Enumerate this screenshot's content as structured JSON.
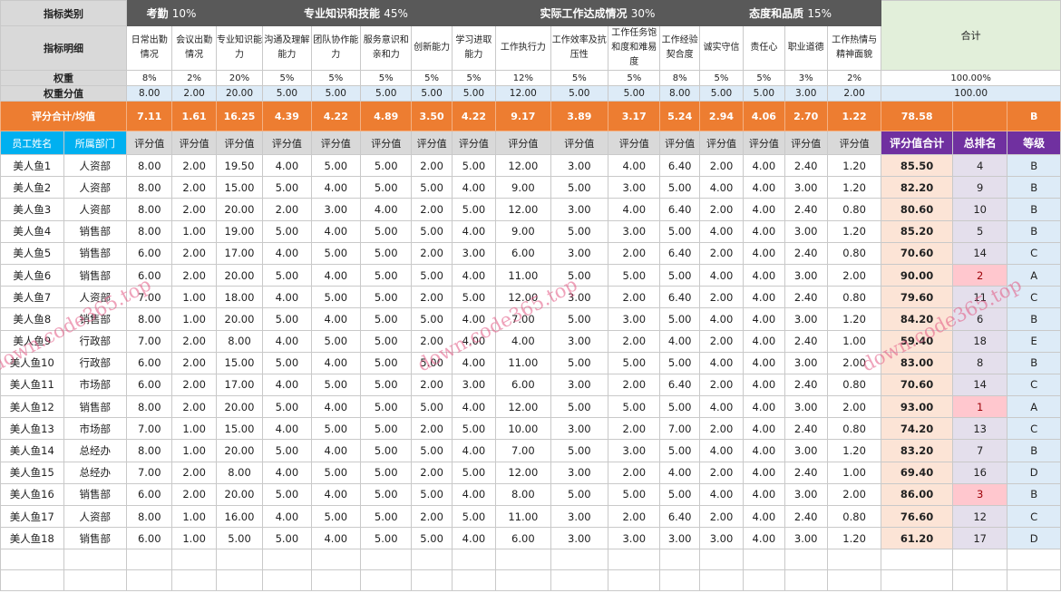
{
  "header": {
    "category_label": "指标类别",
    "categories": [
      {
        "name": "考勤",
        "weight": "10%"
      },
      {
        "name": "专业知识和技能",
        "weight": "45%"
      },
      {
        "name": "实际工作达成情况",
        "weight": "30%"
      },
      {
        "name": "态度和品质",
        "weight": "15%"
      }
    ],
    "total_label": "合计",
    "detail_label": "指标明细",
    "details": [
      "日常出勤情况",
      "会议出勤情况",
      "专业知识能力",
      "沟通及理解能力",
      "团队协作能力",
      "服务意识和亲和力",
      "创新能力",
      "学习进取能力",
      "工作执行力",
      "工作效率及抗压性",
      "工作任务饱和度和难易度",
      "工作经验契合度",
      "诚实守信",
      "责任心",
      "职业道德",
      "工作热情与精神面貌"
    ],
    "weight_label": "权重",
    "weights": [
      "8%",
      "2%",
      "20%",
      "5%",
      "5%",
      "5%",
      "5%",
      "5%",
      "12%",
      "5%",
      "5%",
      "8%",
      "5%",
      "5%",
      "3%",
      "2%"
    ],
    "weight_total": "100.00%",
    "weight_score_label": "权重分值",
    "weight_scores": [
      "8.00",
      "2.00",
      "20.00",
      "5.00",
      "5.00",
      "5.00",
      "5.00",
      "5.00",
      "12.00",
      "5.00",
      "5.00",
      "8.00",
      "5.00",
      "5.00",
      "3.00",
      "2.00"
    ],
    "weight_score_total": "100.00"
  },
  "summary": {
    "label": "评分合计/均值",
    "averages": [
      "7.11",
      "1.61",
      "16.25",
      "4.39",
      "4.22",
      "4.89",
      "3.50",
      "4.22",
      "9.17",
      "3.89",
      "3.17",
      "5.24",
      "2.94",
      "4.06",
      "2.70",
      "1.22"
    ],
    "total": "78.58",
    "grade": "B"
  },
  "columns": {
    "name": "员工姓名",
    "dept": "所属部门",
    "score": "评分值",
    "total": "评分值合计",
    "rank": "总排名",
    "grade": "等级"
  },
  "employees": [
    {
      "name": "美人鱼1",
      "dept": "人资部",
      "scores": [
        "8.00",
        "2.00",
        "19.50",
        "4.00",
        "5.00",
        "5.00",
        "2.00",
        "5.00",
        "12.00",
        "3.00",
        "4.00",
        "6.40",
        "2.00",
        "4.00",
        "2.40",
        "1.20"
      ],
      "total": "85.50",
      "rank": "4",
      "grade": "B"
    },
    {
      "name": "美人鱼2",
      "dept": "人资部",
      "scores": [
        "8.00",
        "2.00",
        "15.00",
        "5.00",
        "4.00",
        "5.00",
        "5.00",
        "4.00",
        "9.00",
        "5.00",
        "3.00",
        "5.00",
        "4.00",
        "4.00",
        "3.00",
        "1.20"
      ],
      "total": "82.20",
      "rank": "9",
      "grade": "B"
    },
    {
      "name": "美人鱼3",
      "dept": "人资部",
      "scores": [
        "8.00",
        "2.00",
        "20.00",
        "2.00",
        "3.00",
        "4.00",
        "2.00",
        "5.00",
        "12.00",
        "3.00",
        "4.00",
        "6.40",
        "2.00",
        "4.00",
        "2.40",
        "0.80"
      ],
      "total": "80.60",
      "rank": "10",
      "grade": "B"
    },
    {
      "name": "美人鱼4",
      "dept": "销售部",
      "scores": [
        "8.00",
        "1.00",
        "19.00",
        "5.00",
        "4.00",
        "5.00",
        "5.00",
        "4.00",
        "9.00",
        "5.00",
        "3.00",
        "5.00",
        "4.00",
        "4.00",
        "3.00",
        "1.20"
      ],
      "total": "85.20",
      "rank": "5",
      "grade": "B"
    },
    {
      "name": "美人鱼5",
      "dept": "销售部",
      "scores": [
        "6.00",
        "2.00",
        "17.00",
        "4.00",
        "5.00",
        "5.00",
        "2.00",
        "3.00",
        "6.00",
        "3.00",
        "2.00",
        "6.40",
        "2.00",
        "4.00",
        "2.40",
        "0.80"
      ],
      "total": "70.60",
      "rank": "14",
      "grade": "C"
    },
    {
      "name": "美人鱼6",
      "dept": "销售部",
      "scores": [
        "6.00",
        "2.00",
        "20.00",
        "5.00",
        "4.00",
        "5.00",
        "5.00",
        "4.00",
        "11.00",
        "5.00",
        "5.00",
        "5.00",
        "4.00",
        "4.00",
        "3.00",
        "2.00"
      ],
      "total": "90.00",
      "rank": "2",
      "grade": "A"
    },
    {
      "name": "美人鱼7",
      "dept": "人资部",
      "scores": [
        "7.00",
        "1.00",
        "18.00",
        "4.00",
        "5.00",
        "5.00",
        "2.00",
        "5.00",
        "12.00",
        "3.00",
        "2.00",
        "6.40",
        "2.00",
        "4.00",
        "2.40",
        "0.80"
      ],
      "total": "79.60",
      "rank": "11",
      "grade": "C"
    },
    {
      "name": "美人鱼8",
      "dept": "销售部",
      "scores": [
        "8.00",
        "1.00",
        "20.00",
        "5.00",
        "4.00",
        "5.00",
        "5.00",
        "4.00",
        "7.00",
        "5.00",
        "3.00",
        "5.00",
        "4.00",
        "4.00",
        "3.00",
        "1.20"
      ],
      "total": "84.20",
      "rank": "6",
      "grade": "B"
    },
    {
      "name": "美人鱼9",
      "dept": "行政部",
      "scores": [
        "7.00",
        "2.00",
        "8.00",
        "4.00",
        "5.00",
        "5.00",
        "2.00",
        "4.00",
        "4.00",
        "3.00",
        "2.00",
        "4.00",
        "2.00",
        "4.00",
        "2.40",
        "1.00"
      ],
      "total": "59.40",
      "rank": "18",
      "grade": "E"
    },
    {
      "name": "美人鱼10",
      "dept": "行政部",
      "scores": [
        "6.00",
        "2.00",
        "15.00",
        "5.00",
        "4.00",
        "5.00",
        "5.00",
        "4.00",
        "11.00",
        "5.00",
        "5.00",
        "5.00",
        "4.00",
        "4.00",
        "3.00",
        "2.00"
      ],
      "total": "83.00",
      "rank": "8",
      "grade": "B"
    },
    {
      "name": "美人鱼11",
      "dept": "市场部",
      "scores": [
        "6.00",
        "2.00",
        "17.00",
        "4.00",
        "5.00",
        "5.00",
        "2.00",
        "3.00",
        "6.00",
        "3.00",
        "2.00",
        "6.40",
        "2.00",
        "4.00",
        "2.40",
        "0.80"
      ],
      "total": "70.60",
      "rank": "14",
      "grade": "C"
    },
    {
      "name": "美人鱼12",
      "dept": "销售部",
      "scores": [
        "8.00",
        "2.00",
        "20.00",
        "5.00",
        "4.00",
        "5.00",
        "5.00",
        "4.00",
        "12.00",
        "5.00",
        "5.00",
        "5.00",
        "4.00",
        "4.00",
        "3.00",
        "2.00"
      ],
      "total": "93.00",
      "rank": "1",
      "grade": "A"
    },
    {
      "name": "美人鱼13",
      "dept": "市场部",
      "scores": [
        "7.00",
        "1.00",
        "15.00",
        "4.00",
        "5.00",
        "5.00",
        "2.00",
        "5.00",
        "10.00",
        "3.00",
        "2.00",
        "7.00",
        "2.00",
        "4.00",
        "2.40",
        "0.80"
      ],
      "total": "74.20",
      "rank": "13",
      "grade": "C"
    },
    {
      "name": "美人鱼14",
      "dept": "总经办",
      "scores": [
        "8.00",
        "1.00",
        "20.00",
        "5.00",
        "4.00",
        "5.00",
        "5.00",
        "4.00",
        "7.00",
        "5.00",
        "3.00",
        "5.00",
        "4.00",
        "4.00",
        "3.00",
        "1.20"
      ],
      "total": "83.20",
      "rank": "7",
      "grade": "B"
    },
    {
      "name": "美人鱼15",
      "dept": "总经办",
      "scores": [
        "7.00",
        "2.00",
        "8.00",
        "4.00",
        "5.00",
        "5.00",
        "2.00",
        "5.00",
        "12.00",
        "3.00",
        "2.00",
        "4.00",
        "2.00",
        "4.00",
        "2.40",
        "1.00"
      ],
      "total": "69.40",
      "rank": "16",
      "grade": "D"
    },
    {
      "name": "美人鱼16",
      "dept": "销售部",
      "scores": [
        "6.00",
        "2.00",
        "20.00",
        "5.00",
        "4.00",
        "5.00",
        "5.00",
        "4.00",
        "8.00",
        "5.00",
        "5.00",
        "5.00",
        "4.00",
        "4.00",
        "3.00",
        "2.00"
      ],
      "total": "86.00",
      "rank": "3",
      "grade": "B"
    },
    {
      "name": "美人鱼17",
      "dept": "人资部",
      "scores": [
        "8.00",
        "1.00",
        "16.00",
        "4.00",
        "5.00",
        "5.00",
        "2.00",
        "5.00",
        "11.00",
        "3.00",
        "2.00",
        "6.40",
        "2.00",
        "4.00",
        "2.40",
        "0.80"
      ],
      "total": "76.60",
      "rank": "12",
      "grade": "C"
    },
    {
      "name": "美人鱼18",
      "dept": "销售部",
      "scores": [
        "6.00",
        "1.00",
        "5.00",
        "5.00",
        "4.00",
        "5.00",
        "5.00",
        "4.00",
        "6.00",
        "3.00",
        "3.00",
        "3.00",
        "3.00",
        "4.00",
        "3.00",
        "1.20"
      ],
      "total": "61.20",
      "rank": "17",
      "grade": "D"
    }
  ],
  "highlighted_ranks": [
    "1",
    "2",
    "3"
  ],
  "watermark": "down.code365.top",
  "colors": {
    "category_header": "#595959",
    "summary_row": "#ed7d31",
    "name_header": "#00b0f0",
    "total_header": "#7030a0",
    "total_column": "#fce4d6",
    "rank_column": "#e4dfec",
    "grade_column": "#ddebf7",
    "top_rank_highlight": "#ffc7ce"
  }
}
